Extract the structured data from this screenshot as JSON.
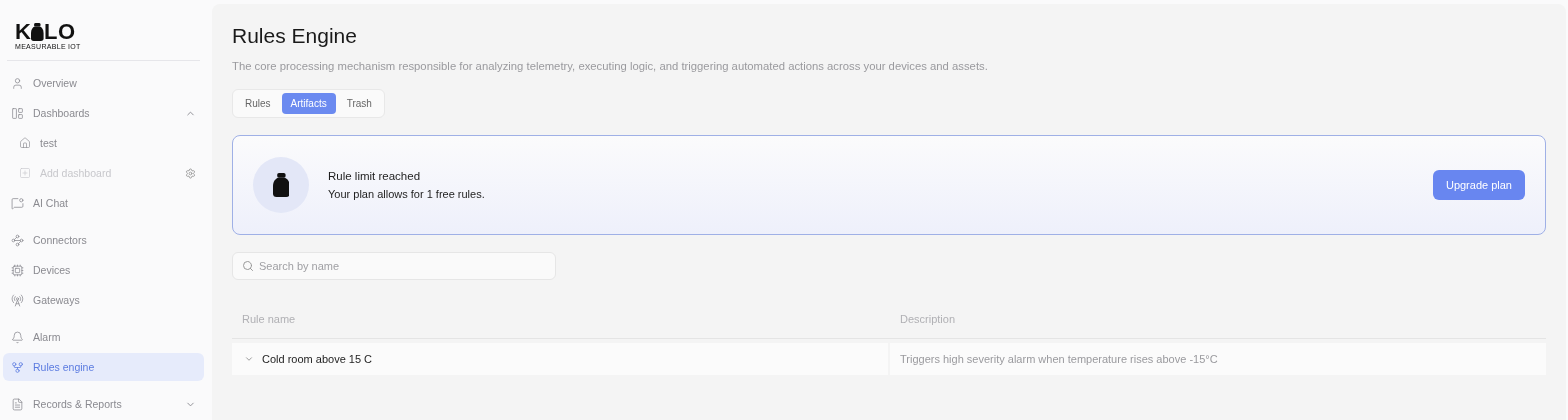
{
  "logo": {
    "left": "K",
    "right": "LO",
    "tagline": "MEASURABLE IOT"
  },
  "sidebar": {
    "groups": [
      {
        "items": [
          {
            "label": "Overview",
            "kind": "item",
            "selected": false
          },
          {
            "label": "Dashboards",
            "kind": "folder",
            "selected": false,
            "expanded": true,
            "children": [
              {
                "label": "test",
                "kind": "sub",
                "disabled": false
              },
              {
                "label": "Add dashboard",
                "kind": "add",
                "disabled": true
              }
            ]
          },
          {
            "label": "AI Chat",
            "kind": "item",
            "selected": false
          }
        ]
      },
      {
        "items": [
          {
            "label": "Connectors",
            "kind": "item",
            "selected": false
          },
          {
            "label": "Devices",
            "kind": "item",
            "selected": false
          },
          {
            "label": "Gateways",
            "kind": "item",
            "selected": false
          }
        ]
      },
      {
        "items": [
          {
            "label": "Alarm",
            "kind": "item",
            "selected": false
          },
          {
            "label": "Rules engine",
            "kind": "item",
            "selected": true
          }
        ]
      },
      {
        "items": [
          {
            "label": "Records & Reports",
            "kind": "folder",
            "selected": false,
            "expanded": false
          }
        ]
      }
    ]
  },
  "page": {
    "title": "Rules Engine",
    "description": "The core processing mechanism responsible for analyzing telemetry, executing logic, and triggering automated actions across your devices and assets."
  },
  "tabs": [
    {
      "label": "Rules",
      "selected": false
    },
    {
      "label": "Artifacts",
      "selected": true
    },
    {
      "label": "Trash",
      "selected": false
    }
  ],
  "banner": {
    "title": "Rule limit reached",
    "text": "Your plan allows for 1 free rules.",
    "button": "Upgrade plan"
  },
  "search": {
    "placeholder": "Search by name"
  },
  "table": {
    "columns": [
      "Rule name",
      "Description"
    ],
    "rows": [
      {
        "name": "Cold room above 15 C",
        "description": "Triggers high severity alarm when temperature rises above -15°C",
        "expanded": false
      }
    ]
  }
}
